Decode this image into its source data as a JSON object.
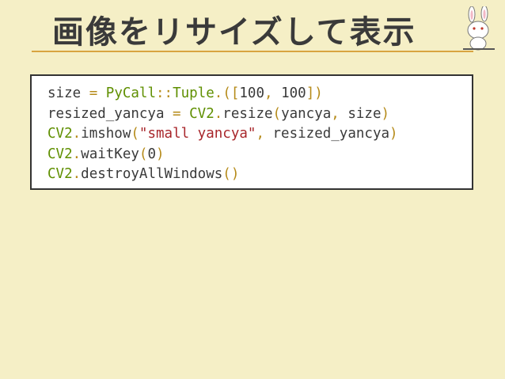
{
  "slide": {
    "title": "画像をリサイズして表示",
    "mascot_icon": "rabbit-mascot-icon"
  },
  "code": {
    "lines": [
      {
        "tokens": [
          {
            "text": "size ",
            "kind": "plain"
          },
          {
            "text": "=",
            "kind": "op"
          },
          {
            "text": " ",
            "kind": "plain"
          },
          {
            "text": "PyCall",
            "kind": "k"
          },
          {
            "text": "::",
            "kind": "op"
          },
          {
            "text": "Tuple",
            "kind": "k"
          },
          {
            "text": ".",
            "kind": "op"
          },
          {
            "text": "([",
            "kind": "op"
          },
          {
            "text": "100",
            "kind": "plain"
          },
          {
            "text": ",",
            "kind": "op"
          },
          {
            "text": " 100",
            "kind": "plain"
          },
          {
            "text": "])",
            "kind": "op"
          }
        ]
      },
      {
        "tokens": [
          {
            "text": "resized_yancya ",
            "kind": "plain"
          },
          {
            "text": "=",
            "kind": "op"
          },
          {
            "text": " ",
            "kind": "plain"
          },
          {
            "text": "CV2",
            "kind": "k"
          },
          {
            "text": ".",
            "kind": "op"
          },
          {
            "text": "resize",
            "kind": "plain"
          },
          {
            "text": "(",
            "kind": "op"
          },
          {
            "text": "yancya",
            "kind": "plain"
          },
          {
            "text": ",",
            "kind": "op"
          },
          {
            "text": " size",
            "kind": "plain"
          },
          {
            "text": ")",
            "kind": "op"
          }
        ]
      },
      {
        "tokens": [
          {
            "text": "CV2",
            "kind": "k"
          },
          {
            "text": ".",
            "kind": "op"
          },
          {
            "text": "imshow",
            "kind": "plain"
          },
          {
            "text": "(",
            "kind": "op"
          },
          {
            "text": "\"small yancya\"",
            "kind": "s"
          },
          {
            "text": ",",
            "kind": "op"
          },
          {
            "text": " resized_yancya",
            "kind": "plain"
          },
          {
            "text": ")",
            "kind": "op"
          }
        ]
      },
      {
        "tokens": [
          {
            "text": "CV2",
            "kind": "k"
          },
          {
            "text": ".",
            "kind": "op"
          },
          {
            "text": "waitKey",
            "kind": "plain"
          },
          {
            "text": "(",
            "kind": "op"
          },
          {
            "text": "0",
            "kind": "plain"
          },
          {
            "text": ")",
            "kind": "op"
          }
        ]
      },
      {
        "tokens": [
          {
            "text": "CV2",
            "kind": "k"
          },
          {
            "text": ".",
            "kind": "op"
          },
          {
            "text": "destroyAllWindows",
            "kind": "plain"
          },
          {
            "text": "()",
            "kind": "op"
          }
        ]
      }
    ]
  },
  "colors": {
    "background": "#f5efc6",
    "rule": "#d9a441",
    "operator": "#b58a18",
    "constant": "#5f8f00",
    "string": "#a8262b"
  }
}
